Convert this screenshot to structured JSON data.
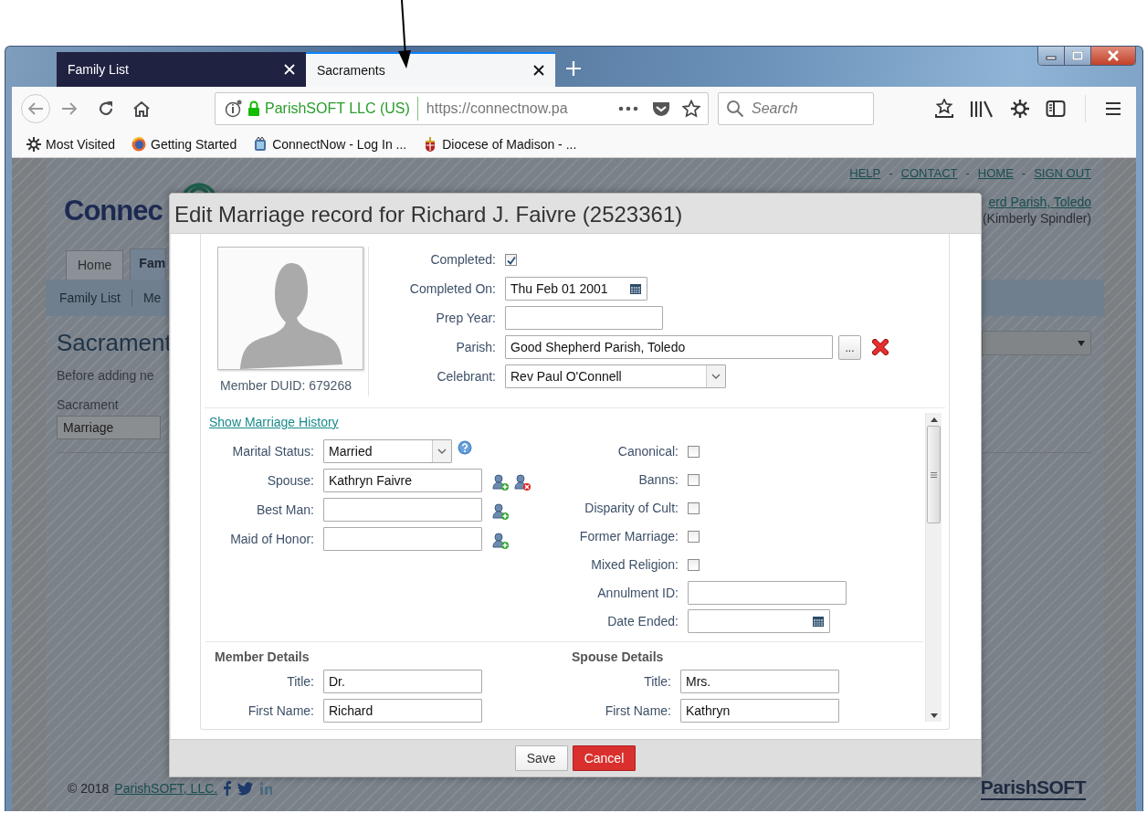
{
  "browser": {
    "tabs": [
      {
        "label": "Family List",
        "selected": false
      },
      {
        "label": "Sacraments",
        "selected": true
      }
    ],
    "address": {
      "identity": "ParishSOFT LLC (US)",
      "url": "https://connectnow.pa"
    },
    "search": {
      "placeholder": "Search"
    },
    "bookmarks": [
      {
        "label": "Most Visited",
        "kind": "gear"
      },
      {
        "label": "Getting Started",
        "kind": "globe"
      },
      {
        "label": "ConnectNow - Log In ...",
        "kind": "app"
      },
      {
        "label": "Diocese of Madison - ...",
        "kind": "crest"
      }
    ]
  },
  "page": {
    "top_links": [
      {
        "label": "HELP"
      },
      {
        "label": "CONTACT"
      },
      {
        "label": "HOME"
      },
      {
        "label": "SIGN OUT"
      }
    ],
    "link_separators": [
      "-",
      "-",
      "-"
    ],
    "logo": "Connec",
    "parish_link": "erd Parish, Toledo",
    "user": "(Kimberly Spindler)",
    "nav_tabs": [
      {
        "label": "Home",
        "selected": false
      },
      {
        "label": "Fam",
        "selected": true
      }
    ],
    "sub_nav": [
      {
        "label": "Family List"
      },
      {
        "label": "Me"
      }
    ],
    "heading": "Sacrament",
    "intro": "Before adding ne",
    "sacrament_label": "Sacrament",
    "sacrament_value": "Marriage",
    "footer": {
      "copyright": "© 2018",
      "company_link": "ParishSOFT, LLC.",
      "brand": "ParishSOFT"
    }
  },
  "dialog": {
    "title": "Edit Marriage record for Richard J. Faivre (2523361)",
    "member_duid": "Member DUID: 679268",
    "record_fields": [
      {
        "kind": "checkbox",
        "label": "Completed:",
        "checked": true
      },
      {
        "kind": "date",
        "label": "Completed On:",
        "value": "Thu Feb 01 2001"
      },
      {
        "kind": "text",
        "label": "Prep Year:"
      },
      {
        "kind": "lookup",
        "label": "Parish:",
        "value": "Good Shepherd Parish, Toledo",
        "button": "..."
      },
      {
        "kind": "select",
        "label": "Celebrant:",
        "value": "Rev Paul O'Connell"
      }
    ],
    "history_link": "Show Marriage History",
    "party_fields": [
      {
        "kind": "status",
        "label": "Marital Status:",
        "value": "Married"
      },
      {
        "kind": "person",
        "label": "Spouse:",
        "value": "Kathryn Faivre",
        "removable": true
      },
      {
        "kind": "person",
        "label": "Best Man:",
        "removable": false
      },
      {
        "kind": "person",
        "label": "Maid of Honor:",
        "removable": false
      }
    ],
    "flags": [
      {
        "kind": "checkbox",
        "label": "Canonical:",
        "checked": false
      },
      {
        "kind": "checkbox",
        "label": "Banns:",
        "checked": false
      },
      {
        "kind": "checkbox",
        "label": "Disparity of Cult:",
        "checked": false
      },
      {
        "kind": "checkbox",
        "label": "Former Marriage:",
        "checked": false
      },
      {
        "kind": "checkbox",
        "label": "Mixed Religion:",
        "checked": false
      },
      {
        "kind": "text",
        "label": "Annulment ID:"
      },
      {
        "kind": "date",
        "label": "Date Ended:"
      }
    ],
    "member_details": {
      "heading": "Member Details",
      "fields": [
        {
          "label": "Title:",
          "value": "Dr."
        },
        {
          "label": "First Name:",
          "value": "Richard"
        }
      ]
    },
    "spouse_details": {
      "heading": "Spouse Details",
      "fields": [
        {
          "label": "Title:",
          "value": "Mrs."
        },
        {
          "label": "First Name:",
          "value": "Kathryn"
        }
      ]
    },
    "buttons": [
      {
        "label": "Save",
        "kind": "default"
      },
      {
        "label": "Cancel",
        "kind": "danger"
      }
    ]
  }
}
